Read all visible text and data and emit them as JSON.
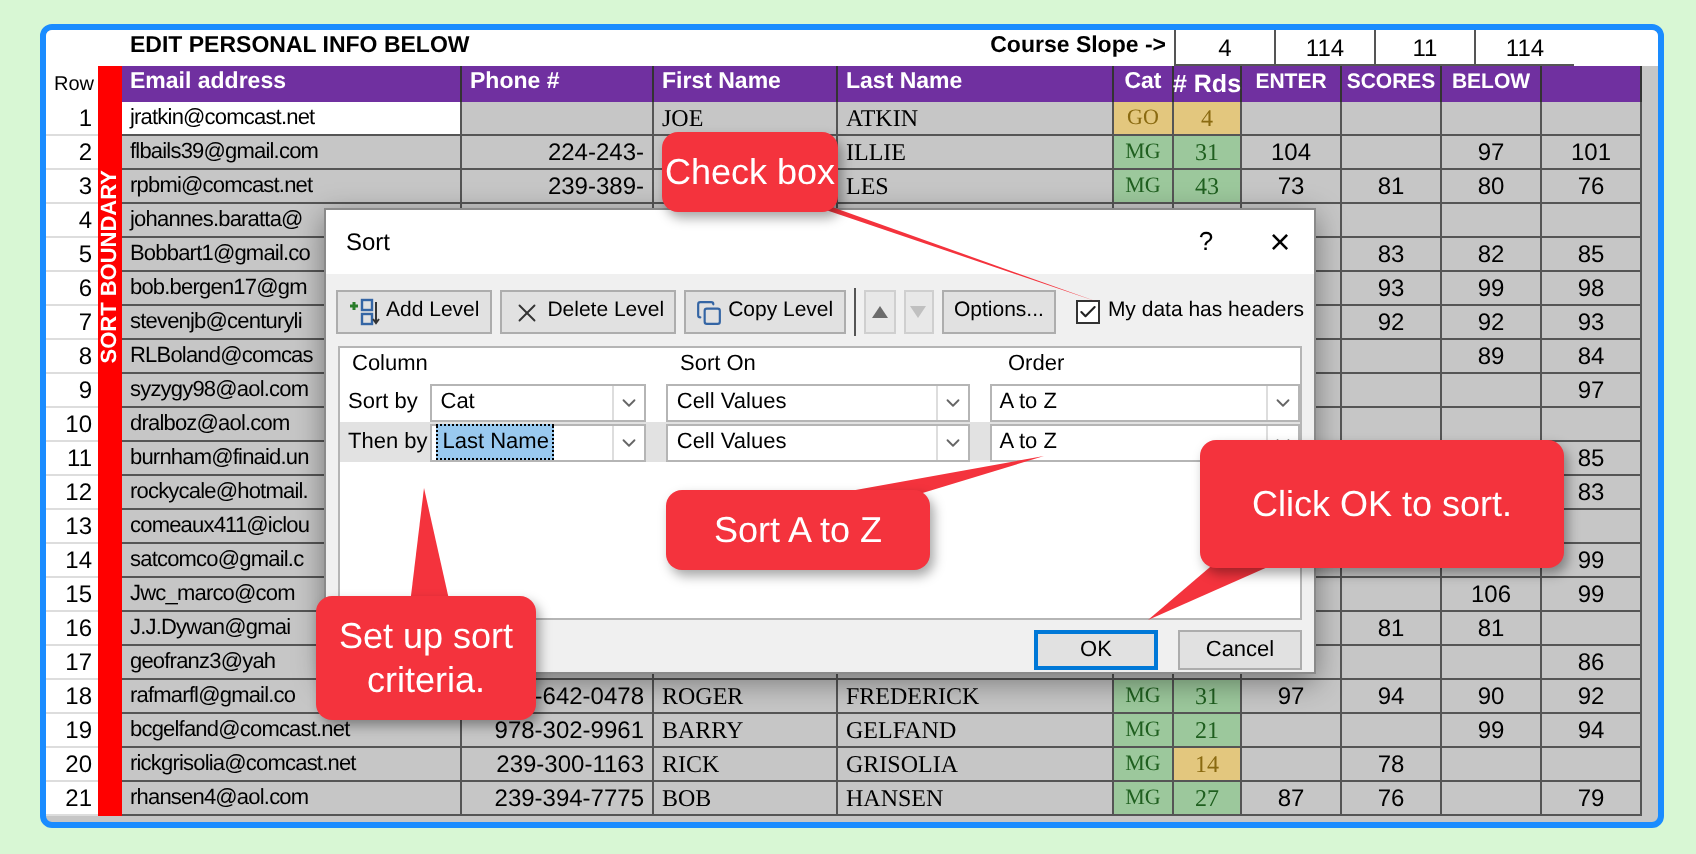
{
  "sheet": {
    "title": "EDIT PERSONAL INFO BELOW",
    "slope_label": "Course Slope ->",
    "slope_values": [
      "4",
      "114",
      "11",
      "114"
    ],
    "row_header": "Row",
    "boundary_label": "SORT BOUNDARY",
    "columns": [
      "Email address",
      "Phone #",
      "First Name",
      "Last Name",
      "Cat",
      "# Rds",
      "ENTER",
      "SCORES",
      "BELOW"
    ],
    "rows": [
      {
        "number": "1",
        "email": "jratkin@comcast.net",
        "first_name": "JOE",
        "last_name": "ATKIN",
        "cat": {
          "text": "GO",
          "color": "#e3c77e"
        },
        "rds": {
          "text": "4",
          "color": "#e3c77e"
        }
      },
      {
        "number": "2",
        "email": "flbails39@gmail.com",
        "phone": "224-243-",
        "last_name": "ILLIE",
        "cat": {
          "text": "MG",
          "color": "#9cc89c"
        },
        "rds": {
          "text": "31",
          "color": "#9cc89c"
        },
        "enter": "104",
        "below": "97",
        "column_10": "101"
      },
      {
        "number": "3",
        "email": "rpbmi@comcast.net",
        "phone": "239-389-",
        "last_name": "LES",
        "cat": {
          "text": "MG",
          "color": "#9cc89c"
        },
        "rds": {
          "text": "43",
          "color": "#9cc89c"
        },
        "enter": "73",
        "scores": "81",
        "below": "80",
        "column_10": "76"
      },
      {
        "number": "4",
        "email": "johannes.baratta@"
      },
      {
        "number": "5",
        "email": "Bobbart1@gmail.co",
        "scores": "83",
        "below": "82",
        "column_10": "85"
      },
      {
        "number": "6",
        "email": "bob.bergen17@gm",
        "scores": "93",
        "below": "99",
        "column_10": "98"
      },
      {
        "number": "7",
        "email": "stevenjb@centuryli",
        "scores": "92",
        "below": "92",
        "column_10": "93"
      },
      {
        "number": "8",
        "email": "RLBoland@comcas",
        "below": "89",
        "column_10": "84"
      },
      {
        "number": "9",
        "email": "syzygy98@aol.com",
        "column_10": "97"
      },
      {
        "number": "10",
        "email": "dralboz@aol.com"
      },
      {
        "number": "11",
        "email": "burnham@finaid.un",
        "column_10": "85"
      },
      {
        "number": "12",
        "email": "rockycale@hotmail.",
        "column_10": "83"
      },
      {
        "number": "13",
        "email": "comeaux411@iclou"
      },
      {
        "number": "14",
        "email": "satcomco@gmail.c",
        "column_10": "99"
      },
      {
        "number": "15",
        "email": "Jwc_marco@com",
        "below": "106",
        "column_10": "99"
      },
      {
        "number": "16",
        "email": "J.J.Dywan@gmai",
        "scores": "81",
        "below": "81"
      },
      {
        "number": "17",
        "email": "geofranz3@yah",
        "column_10": "86"
      },
      {
        "number": "18",
        "email": "rafmarfl@gmail.co",
        "phone": "-642-0478",
        "first_name": "ROGER",
        "last_name": "FREDERICK",
        "cat": {
          "text": "MG",
          "color": "#9cc89c"
        },
        "rds": {
          "text": "31",
          "color": "#9cc89c"
        },
        "enter": "97",
        "scores": "94",
        "below": "90",
        "column_10": "92"
      },
      {
        "number": "19",
        "email": "bcgelfand@comcast.net",
        "phone": "978-302-9961",
        "first_name": "BARRY",
        "last_name": "GELFAND",
        "cat": {
          "text": "MG",
          "color": "#9cc89c"
        },
        "rds": {
          "text": "21",
          "color": "#9cc89c"
        },
        "below": "99",
        "column_10": "94"
      },
      {
        "number": "20",
        "email": "rickgrisolia@comcast.net",
        "phone": "239-300-1163",
        "first_name": "RICK",
        "last_name": "GRISOLIA",
        "cat": {
          "text": "MG",
          "color": "#9cc89c"
        },
        "rds": {
          "text": "14",
          "color": "#e3c77e"
        },
        "scores": "78"
      },
      {
        "number": "21",
        "email": "rhansen4@aol.com",
        "phone": "239-394-7775",
        "first_name": "BOB",
        "last_name": "HANSEN",
        "cat": {
          "text": "MG",
          "color": "#9cc89c"
        },
        "rds": {
          "text": "27",
          "color": "#9cc89c"
        },
        "enter": "87",
        "scores": "76",
        "column_10": "79"
      }
    ]
  },
  "dialog": {
    "title": "Sort",
    "help": "?",
    "close": "×",
    "toolbar": [
      {
        "kind": "add",
        "label": "Add Level"
      },
      {
        "kind": "delete",
        "label": "Delete Level"
      },
      {
        "kind": "copy",
        "label": "Copy Level"
      },
      {
        "kind": "up",
        "disabled": false
      },
      {
        "kind": "down",
        "disabled": true
      },
      {
        "kind": "options",
        "label": "Options..."
      }
    ],
    "headers_checkbox": {
      "label": "My data has headers",
      "checked": true
    },
    "grid_headers": [
      "Column",
      "Sort On",
      "Order"
    ],
    "levels": [
      {
        "label": "Sort by",
        "column": "Cat",
        "sort_on": "Cell Values",
        "order": "A to Z",
        "selected": false
      },
      {
        "label": "Then by",
        "column": "Last Name",
        "sort_on": "Cell Values",
        "order": "A to Z",
        "selected": true
      }
    ],
    "buttons": [
      {
        "label": "OK",
        "default": true
      },
      {
        "label": "Cancel",
        "default": false
      }
    ]
  },
  "callouts": [
    {
      "text": "Check box"
    },
    {
      "text": "Sort A to Z"
    },
    {
      "text": "Click OK to sort."
    },
    {
      "text": "Set up sort criteria."
    }
  ]
}
